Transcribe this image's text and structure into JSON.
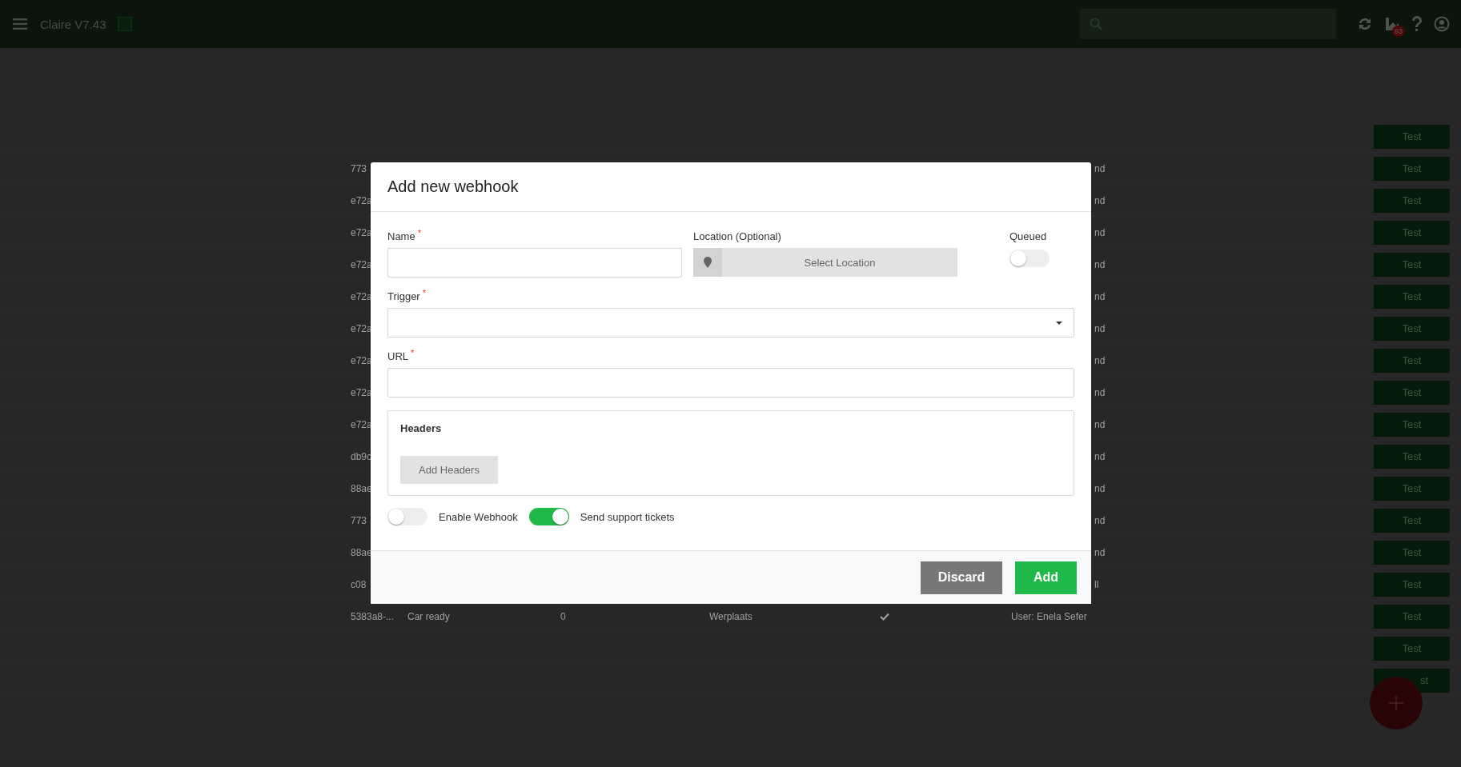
{
  "app_bar": {
    "title": "Claire V7.43",
    "notification_count": "93"
  },
  "table": {
    "rows": [
      {
        "kind": "hidden",
        "test_label": "Test"
      },
      {
        "kind": "covered",
        "hash": "773",
        "user": "nd",
        "test_label": "Test"
      },
      {
        "kind": "covered",
        "hash": "e72a",
        "user": "nd",
        "test_label": "Test"
      },
      {
        "kind": "covered",
        "hash": "e72a",
        "user": "nd",
        "test_label": "Test"
      },
      {
        "kind": "covered",
        "hash": "e72a",
        "user": "nd",
        "test_label": "Test"
      },
      {
        "kind": "covered",
        "hash": "e72a",
        "user": "nd",
        "test_label": "Test"
      },
      {
        "kind": "covered",
        "hash": "e72a",
        "user": "nd",
        "test_label": "Test"
      },
      {
        "kind": "covered",
        "hash": "e72a",
        "user": "nd",
        "test_label": "Test"
      },
      {
        "kind": "covered",
        "hash": "e72a",
        "user": "nd",
        "test_label": "Test"
      },
      {
        "kind": "covered",
        "hash": "e72a",
        "user": "nd",
        "test_label": "Test"
      },
      {
        "kind": "covered",
        "hash": "db9c",
        "user": "nd",
        "test_label": "Test"
      },
      {
        "kind": "covered",
        "hash": "88ae",
        "user": "nd",
        "test_label": "Test"
      },
      {
        "kind": "covered",
        "hash": "773",
        "user": "nd",
        "test_label": "Test"
      },
      {
        "kind": "covered",
        "hash": "88ae",
        "user": "nd",
        "test_label": "Test"
      },
      {
        "kind": "covered",
        "hash": "c08",
        "user": "ll",
        "test_label": "Test"
      },
      {
        "kind": "full",
        "hash": "5383a8-...",
        "trigger": "Car ready",
        "count": "0",
        "location": "Werplaats",
        "queued": true,
        "user": "User: Enela Sefer",
        "test_label": "Test"
      },
      {
        "kind": "hidden",
        "test_label": "Test"
      },
      {
        "kind": "cut",
        "test_label": "st"
      }
    ]
  },
  "dialog": {
    "title": "Add new webhook",
    "name": {
      "label": "Name",
      "required_mark": "*"
    },
    "location": {
      "label": "Location (Optional)",
      "button": "Select Location"
    },
    "queued": {
      "label": "Queued",
      "on": false
    },
    "trigger": {
      "label": "Trigger",
      "required_mark": "*"
    },
    "url": {
      "label": "URL",
      "required_mark": "*"
    },
    "headers": {
      "title": "Headers",
      "button": "Add Headers"
    },
    "toggles": [
      {
        "label": "Enable Webhook",
        "on": false
      },
      {
        "label": "Send support tickets",
        "on": true
      }
    ],
    "buttons": [
      {
        "label": "Discard",
        "kind": "secondary"
      },
      {
        "label": "Add",
        "kind": "primary"
      }
    ]
  }
}
